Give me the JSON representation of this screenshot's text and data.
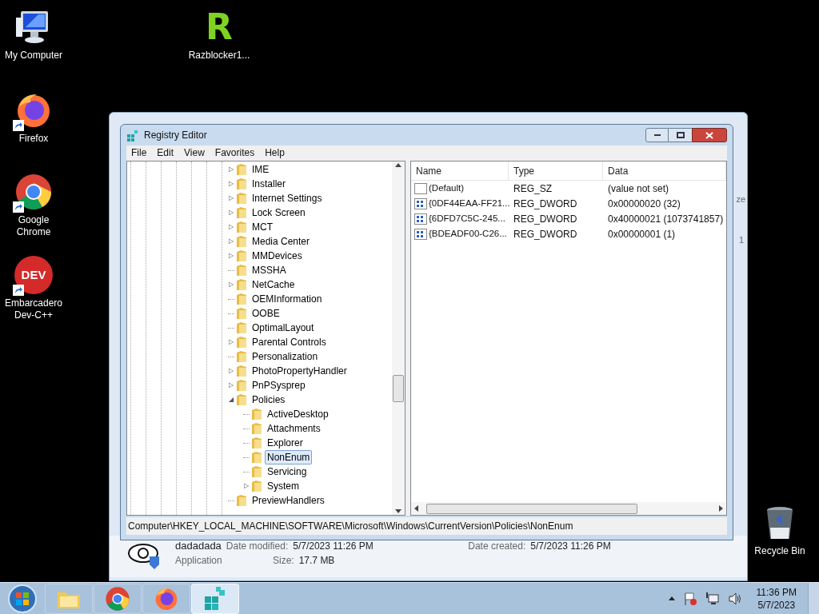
{
  "desktop_icons": [
    {
      "kind": "computer",
      "label": "My Computer"
    },
    {
      "kind": "razblocker",
      "label": "Razblocker1...",
      "glyph": "R"
    },
    {
      "kind": "firefox",
      "label": "Firefox"
    },
    {
      "kind": "chrome",
      "label": "Google Chrome"
    },
    {
      "kind": "devcpp",
      "label": "Embarcadero Dev-C++",
      "glyph": "DEV"
    },
    {
      "kind": "recycle",
      "label": "Recycle Bin"
    }
  ],
  "background_window": {
    "file_name": "dadadada",
    "file_type": "Application",
    "date_modified_label": "Date modified:",
    "date_modified": "5/7/2023 11:26 PM",
    "date_created_label": "Date created:",
    "date_created": "5/7/2023 11:26 PM",
    "size_label": "Size:",
    "size": "17.7 MB",
    "column_fragment": "ze",
    "cell_fragment": "1"
  },
  "window": {
    "title": "Registry Editor"
  },
  "menu": [
    "File",
    "Edit",
    "View",
    "Favorites",
    "Help"
  ],
  "tree": [
    {
      "label": "IME",
      "expander": "▷",
      "selected": false
    },
    {
      "label": "Installer",
      "expander": "▷",
      "selected": false
    },
    {
      "label": "Internet Settings",
      "expander": "▷",
      "selected": false
    },
    {
      "label": "Lock Screen",
      "expander": "▷",
      "selected": false
    },
    {
      "label": "MCT",
      "expander": "▷",
      "selected": false
    },
    {
      "label": "Media Center",
      "expander": "▷",
      "selected": false
    },
    {
      "label": "MMDevices",
      "expander": "▷",
      "selected": false
    },
    {
      "label": "MSSHA",
      "selected": false
    },
    {
      "label": "NetCache",
      "expander": "▷",
      "selected": false
    },
    {
      "label": "OEMInformation",
      "selected": false
    },
    {
      "label": "OOBE",
      "selected": false
    },
    {
      "label": "OptimalLayout",
      "selected": false
    },
    {
      "label": "Parental Controls",
      "expander": "▷",
      "selected": false
    },
    {
      "label": "Personalization",
      "selected": false
    },
    {
      "label": "PhotoPropertyHandler",
      "expander": "▷",
      "selected": false
    },
    {
      "label": "PnPSysprep",
      "expander": "▷",
      "selected": false
    },
    {
      "label": "Policies",
      "expander": "◢",
      "selected": false,
      "children": [
        {
          "label": "ActiveDesktop",
          "selected": false
        },
        {
          "label": "Attachments",
          "selected": false
        },
        {
          "label": "Explorer",
          "selected": false
        },
        {
          "label": "NonEnum",
          "selected": true
        },
        {
          "label": "Servicing",
          "selected": false
        },
        {
          "label": "System",
          "expander": "▷",
          "selected": false
        }
      ]
    },
    {
      "label": "PreviewHandlers",
      "selected": false
    }
  ],
  "values_table": {
    "columns": [
      "Name",
      "Type",
      "Data"
    ],
    "rows": [
      {
        "kind": "string",
        "name": "(Default)",
        "type": "REG_SZ",
        "data": "(value not set)"
      },
      {
        "kind": "binary",
        "name": "{0DF44EAA-FF21...",
        "type": "REG_DWORD",
        "data": "0x00000020 (32)"
      },
      {
        "kind": "binary",
        "name": "{6DFD7C5C-245...",
        "type": "REG_DWORD",
        "data": "0x40000021 (1073741857)"
      },
      {
        "kind": "binary",
        "name": "{BDEADF00-C26...",
        "type": "REG_DWORD",
        "data": "0x00000001 (1)"
      }
    ]
  },
  "status_bar": "Computer\\HKEY_LOCAL_MACHINE\\SOFTWARE\\Microsoft\\Windows\\CurrentVersion\\Policies\\NonEnum",
  "taskbar": {
    "apps": [
      {
        "kind": "explorer",
        "selected": false
      },
      {
        "kind": "chrome",
        "selected": false
      },
      {
        "kind": "firefox",
        "selected": false
      },
      {
        "kind": "regedit",
        "selected": true
      }
    ],
    "time": "11:36 PM",
    "date": "5/7/2023"
  }
}
